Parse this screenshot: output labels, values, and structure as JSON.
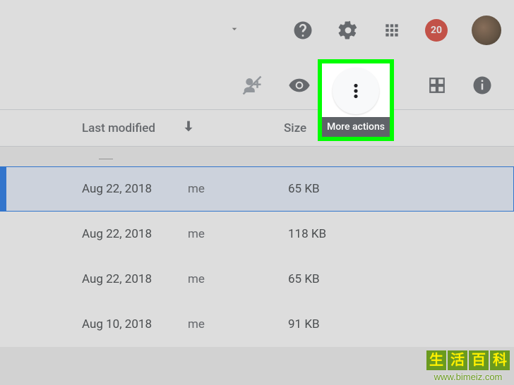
{
  "topbar": {
    "notification_count": "20"
  },
  "actionbar": {
    "more_tooltip": "More actions"
  },
  "columns": {
    "modified": "Last modified",
    "size": "Size"
  },
  "rows": [
    {
      "date": "Aug 22, 2018",
      "owner": "me",
      "size": "65 KB",
      "selected": true
    },
    {
      "date": "Aug 22, 2018",
      "owner": "me",
      "size": "118 KB",
      "selected": false
    },
    {
      "date": "Aug 22, 2018",
      "owner": "me",
      "size": "65 KB",
      "selected": false
    },
    {
      "date": "Aug 10, 2018",
      "owner": "me",
      "size": "91 KB",
      "selected": false
    }
  ],
  "watermark": {
    "c1": "生",
    "c2": "活",
    "c3": "百",
    "c4": "科",
    "url": "www.bimeiz.com"
  }
}
